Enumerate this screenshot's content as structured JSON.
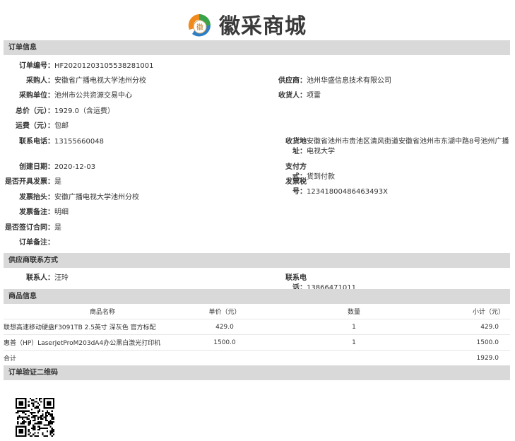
{
  "brand": {
    "title": "徽采商城",
    "logo_text": "徽"
  },
  "sections": {
    "order_info": "订单信息",
    "supplier_contact": "供应商联系方式",
    "goods_info": "商品信息",
    "qr_code": "订单验证二维码"
  },
  "order": {
    "order_no_label": "订单编号：",
    "order_no": "HF20201203105538281001",
    "buyer_label": "采购人：",
    "buyer": "安徽省广播电视大学池州分校",
    "supplier_label": "供应商：",
    "supplier": "池州华盛信息技术有限公司",
    "buyer_unit_label": "采购单位：",
    "buyer_unit": "池州市公共资源交易中心",
    "receiver_label": "收货人：",
    "receiver": "项雷",
    "total_label": "总价（元）：",
    "total": "1929.0（含运费）",
    "shipping_label": "运费（元）：",
    "shipping": "包邮",
    "phone_label": "联系电话：",
    "phone": "13155660048",
    "address_label": "收货地址：",
    "address": "安徽省池州市贵池区清风街道安徽省池州市东湖中路8号池州广播电视大学",
    "created_label": "创建日期：",
    "created": "2020-12-03",
    "payment_label": "支付方式：",
    "payment": "货到付款",
    "invoice_label": "是否开具发票：",
    "invoice": "是",
    "tax_no_label": "发票税号：",
    "tax_no": "12341800486463493X",
    "invoice_title_label": "发票抬头：",
    "invoice_title": "安徽广播电视大学池州分校",
    "invoice_note_label": "发票备注：",
    "invoice_note": "明细",
    "contract_label": "是否签订合同：",
    "contract": "是",
    "order_note_label": "订单备注：",
    "order_note": ""
  },
  "supplier_contact": {
    "contact_label": "联系人：",
    "contact": "汪玲",
    "phone_label": "联系电话：",
    "phone": "13866471011"
  },
  "goods": {
    "headers": [
      "商品名称",
      "单价（元）",
      "数量",
      "小计（元）"
    ],
    "rows": [
      [
        "联想高速移动硬盘F3091TB 2.5英寸 深灰色 官方标配",
        "429.0",
        "1",
        "429.0"
      ],
      [
        "惠普（HP）LaserJetProM203dA4办公黑白激光打印机",
        "1500.0",
        "1",
        "1500.0"
      ]
    ],
    "total_label": "合计",
    "total_value": "1929.0"
  }
}
